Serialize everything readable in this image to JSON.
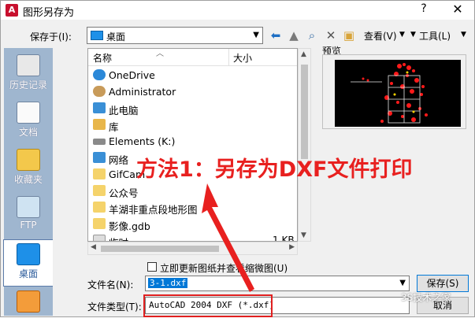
{
  "window": {
    "title": "图形另存为",
    "help_glyph": "?",
    "close_glyph": "✕"
  },
  "toolbar": {
    "save_in_label": "保存于(I):",
    "location": "桌面",
    "view_label": "查看(V)",
    "tools_label": "工具(L)"
  },
  "places": [
    {
      "label": "历史记录",
      "icon": "history-icon"
    },
    {
      "label": "文档",
      "icon": "documents-icon"
    },
    {
      "label": "收藏夹",
      "icon": "favorites-icon"
    },
    {
      "label": "FTP",
      "icon": "ftp-icon"
    },
    {
      "label": "桌面",
      "icon": "desktop-icon",
      "selected": true
    },
    {
      "label": "",
      "icon": "buzzsaw-icon"
    }
  ],
  "filelist": {
    "col_name": "名称",
    "col_size": "大小",
    "rows": [
      {
        "name": "OneDrive",
        "size": "",
        "icon": "onedrive-icon",
        "color": "#2b88d8"
      },
      {
        "name": "Administrator",
        "size": "",
        "icon": "user-icon",
        "color": "#c89b5a"
      },
      {
        "name": "此电脑",
        "size": "",
        "icon": "computer-icon",
        "color": "#3a8fd6"
      },
      {
        "name": "库",
        "size": "",
        "icon": "library-icon",
        "color": "#e8b64a"
      },
      {
        "name": "Elements (K:)",
        "size": "",
        "icon": "drive-icon",
        "color": "#8a8a8a"
      },
      {
        "name": "网络",
        "size": "",
        "icon": "network-icon",
        "color": "#3a8fd6"
      },
      {
        "name": "GifCam",
        "size": "",
        "icon": "folder-icon",
        "color": "#f5d36b"
      },
      {
        "name": "公众号",
        "size": "",
        "icon": "folder-icon",
        "color": "#f5d36b"
      },
      {
        "name": "羊湖非重点段地形图",
        "size": "",
        "icon": "folder-icon",
        "color": "#f5d36b"
      },
      {
        "name": "影像.gdb",
        "size": "",
        "icon": "folder-icon",
        "color": "#f5d36b"
      },
      {
        "name": "临时",
        "size": "1 KB",
        "icon": "file-icon",
        "color": "#dddddd"
      }
    ]
  },
  "preview": {
    "label": "预览"
  },
  "update_checkbox": {
    "label": "立即更新图纸并查看缩微图(U)"
  },
  "filename": {
    "label": "文件名(N):",
    "value": "3-1.dxf"
  },
  "filetype": {
    "label": "文件类型(T):",
    "value": "AutoCAD 2004 DXF (*.dxf)"
  },
  "buttons": {
    "save": "保存(S)",
    "cancel": "取消"
  },
  "annotation": {
    "text": "方法1：另存为DXF文件打印",
    "color": "#e8201f"
  },
  "watermark": "3S技术之家"
}
